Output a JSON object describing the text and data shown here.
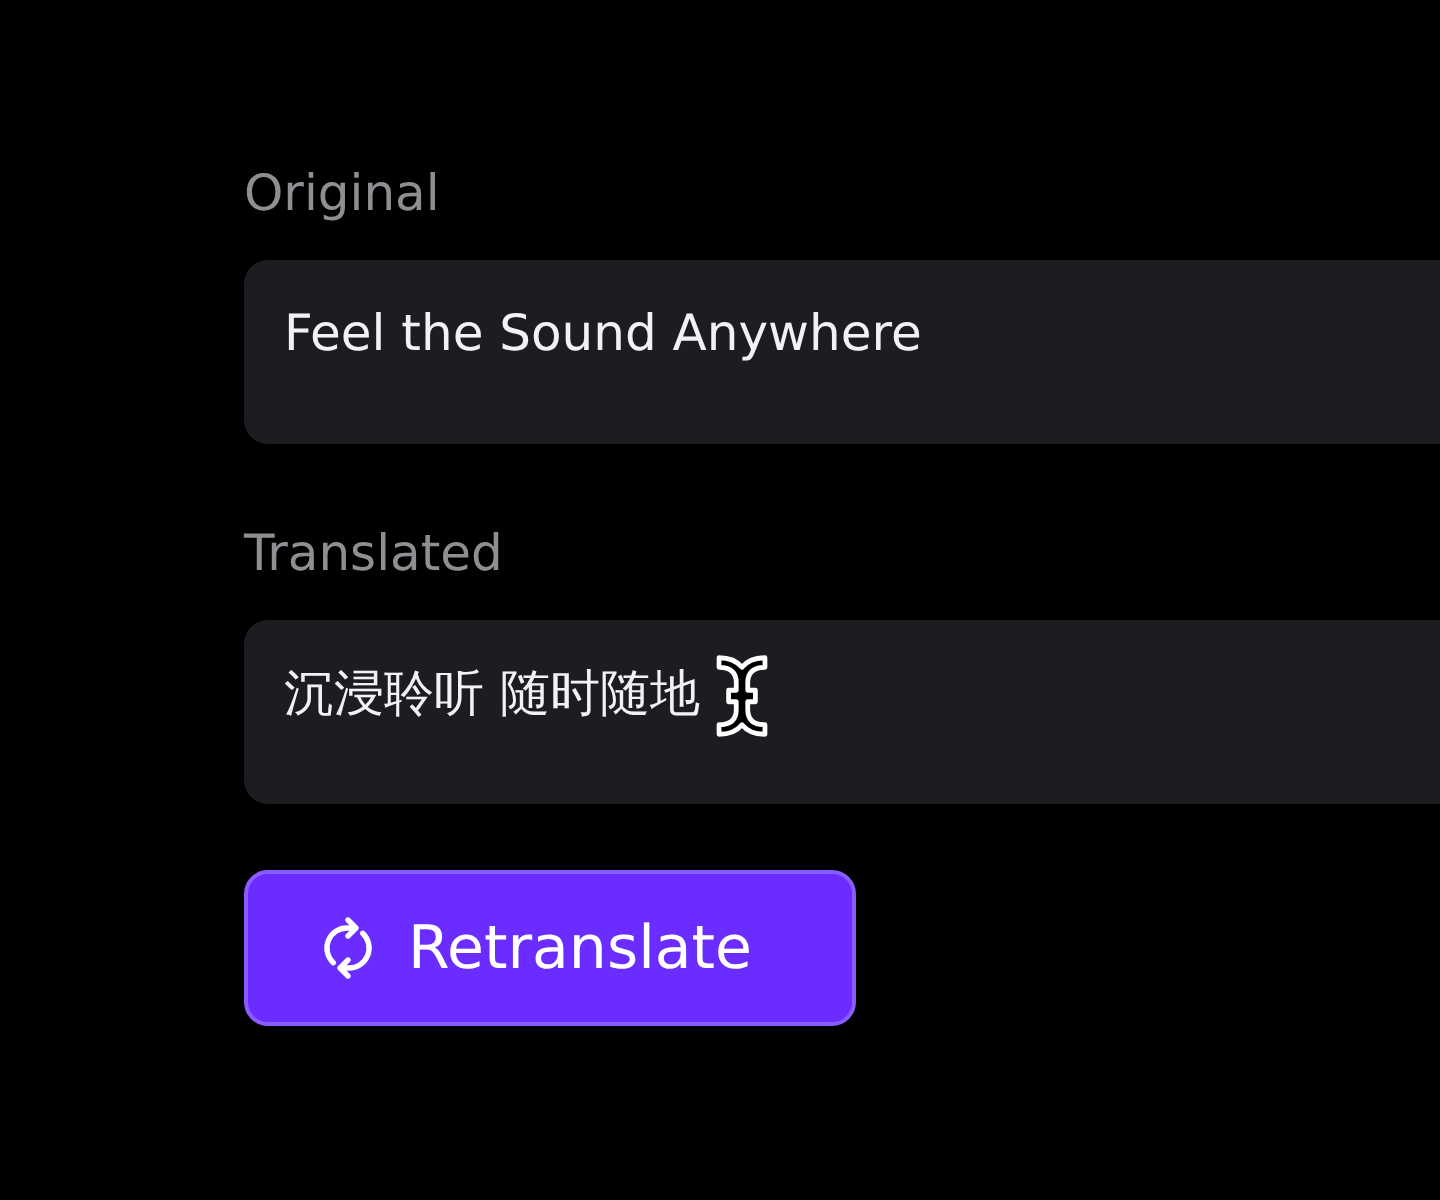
{
  "fields": [
    {
      "label": "Original",
      "value": "Feel the Sound Anywhere",
      "cursor": false
    },
    {
      "label": "Translated",
      "value": "沉浸聆听 随时随地",
      "cursor": true
    }
  ],
  "button": {
    "label": "Retranslate"
  }
}
